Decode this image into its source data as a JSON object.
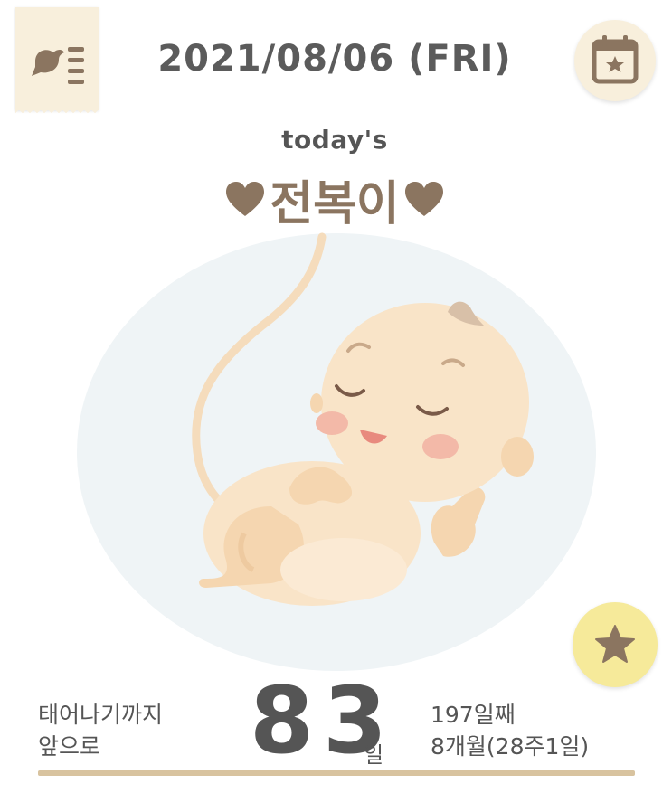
{
  "header": {
    "date": "2021/08/06 (FRI)",
    "menu_icon": "bird-list-icon",
    "calendar_icon": "calendar-star-icon"
  },
  "today": {
    "label": "today's",
    "name": "전복이",
    "heart_color": "#8b7560"
  },
  "illustration": {
    "icon": "fetus-illustration"
  },
  "favorite": {
    "icon": "star-icon",
    "color": "#f6ea9a"
  },
  "countdown": {
    "label_line1": "태어나기까지",
    "label_line2": "앞으로",
    "days": "83",
    "unit": "일",
    "day_count": "197일째",
    "month_week": "8개월(28주1일)"
  },
  "colors": {
    "accent": "#d8c39f",
    "cream": "#f8efdc",
    "brown": "#8b7560",
    "text": "#555555"
  }
}
